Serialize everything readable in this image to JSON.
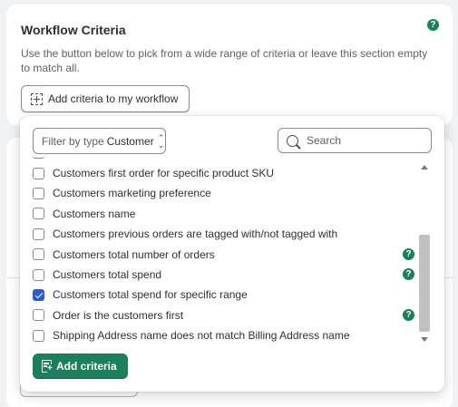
{
  "workflow_card": {
    "title": "Workflow Criteria",
    "description": "Use the button below to pick from a wide range of criteria or leave this section empty to match all.",
    "add_button_label": "Add criteria to my workflow",
    "help_icon": "?"
  },
  "popover": {
    "filter": {
      "label": "Filter by type",
      "value": "Customer",
      "icon": "chevron-up-down-icon"
    },
    "search": {
      "placeholder": "Search",
      "value": ""
    },
    "items": [
      {
        "label": "Customers first order for specific product SKU",
        "checked": false,
        "help": false
      },
      {
        "label": "Customers marketing preference",
        "checked": false,
        "help": false
      },
      {
        "label": "Customers name",
        "checked": false,
        "help": false
      },
      {
        "label": "Customers previous orders are tagged with/not tagged with",
        "checked": false,
        "help": false
      },
      {
        "label": "Customers total number of orders",
        "checked": false,
        "help": true
      },
      {
        "label": "Customers total spend",
        "checked": false,
        "help": true
      },
      {
        "label": "Customers total spend for specific range",
        "checked": true,
        "help": false
      },
      {
        "label": "Order is the customers first",
        "checked": false,
        "help": true
      },
      {
        "label": "Shipping Address name does not match Billing Address name",
        "checked": false,
        "help": false
      }
    ],
    "help_icon": "?",
    "add_button_label": "Add criteria"
  },
  "colors": {
    "accent": "#1a7f5a",
    "checkbox_checked": "#2f5bc8"
  }
}
